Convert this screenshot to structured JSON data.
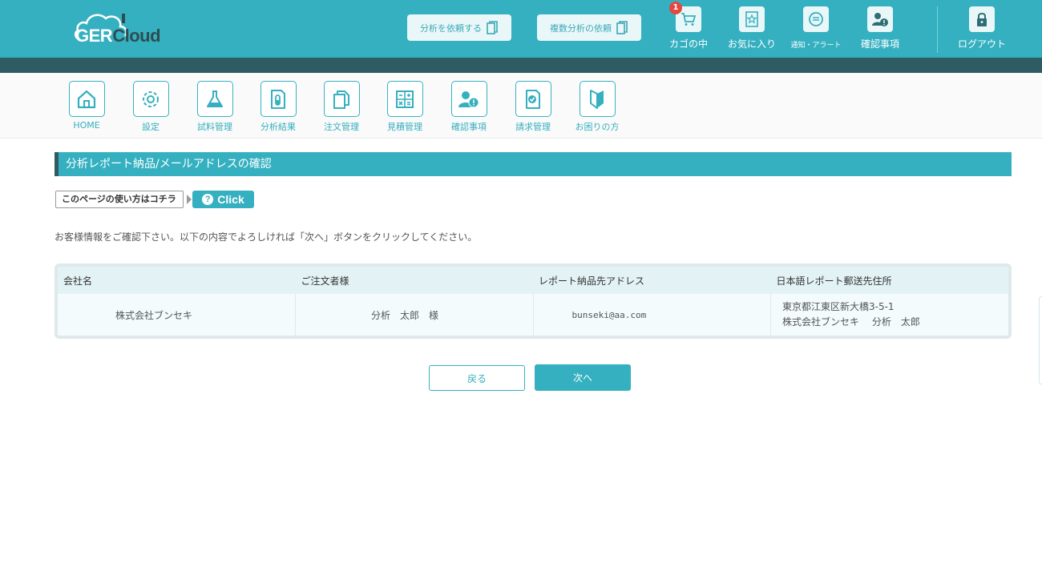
{
  "header": {
    "logo": {
      "text_ger": "GER",
      "text_cloud": "Cloud"
    },
    "request_analysis_label": "分析を依頼する",
    "request_multiple_label": "複数分析の依頼",
    "cart": {
      "label": "カゴの中",
      "badge_count": "1",
      "icon": "cart-icon"
    },
    "favorites": {
      "label": "お気に入り",
      "icon": "star-document-icon"
    },
    "notifications": {
      "label": "通知・アラート",
      "icon": "chat-bubble-icon"
    },
    "confirmations": {
      "label": "確認事項",
      "icon": "user-alert-icon"
    },
    "logout": {
      "label": "ログアウト",
      "icon": "lock-icon"
    }
  },
  "nav": {
    "items": [
      {
        "label": "HOME",
        "icon": "home-icon"
      },
      {
        "label": "設定",
        "icon": "gear-icon"
      },
      {
        "label": "試料管理",
        "icon": "flask-icon"
      },
      {
        "label": "分析結果",
        "icon": "test-tube-document-icon"
      },
      {
        "label": "注文管理",
        "icon": "documents-icon"
      },
      {
        "label": "見積管理",
        "icon": "calculator-icon"
      },
      {
        "label": "確認事項",
        "icon": "user-alert-icon"
      },
      {
        "label": "請求管理",
        "icon": "check-document-icon"
      },
      {
        "label": "お困りの方",
        "icon": "beginner-mark-icon"
      }
    ]
  },
  "page": {
    "title": "分析レポート納品/メールアドレスの確認",
    "howto_label": "このページの使い方はコチラ",
    "click_label": "Click",
    "instruction": "お客様情報をご確認下さい。以下の内容でよろしければ「次へ」ボタンをクリックしてください。"
  },
  "table": {
    "headers": [
      "会社名",
      "ご注文者様",
      "レポート納品先アドレス",
      "日本語レポート郵送先住所"
    ],
    "row": {
      "company": "株式会社ブンセキ",
      "orderer": "分析　太郎　様",
      "email": "bunseki@aa.com",
      "address_line1": "東京都江東区新大橋3-5-1",
      "address_line2": "株式会社ブンセキ　 分析　太郎"
    }
  },
  "actions": {
    "back_label": "戻る",
    "next_label": "次へ"
  },
  "colors": {
    "primary": "#35b0c0",
    "dark_band": "#2f5c62",
    "badge": "#e5463f"
  }
}
